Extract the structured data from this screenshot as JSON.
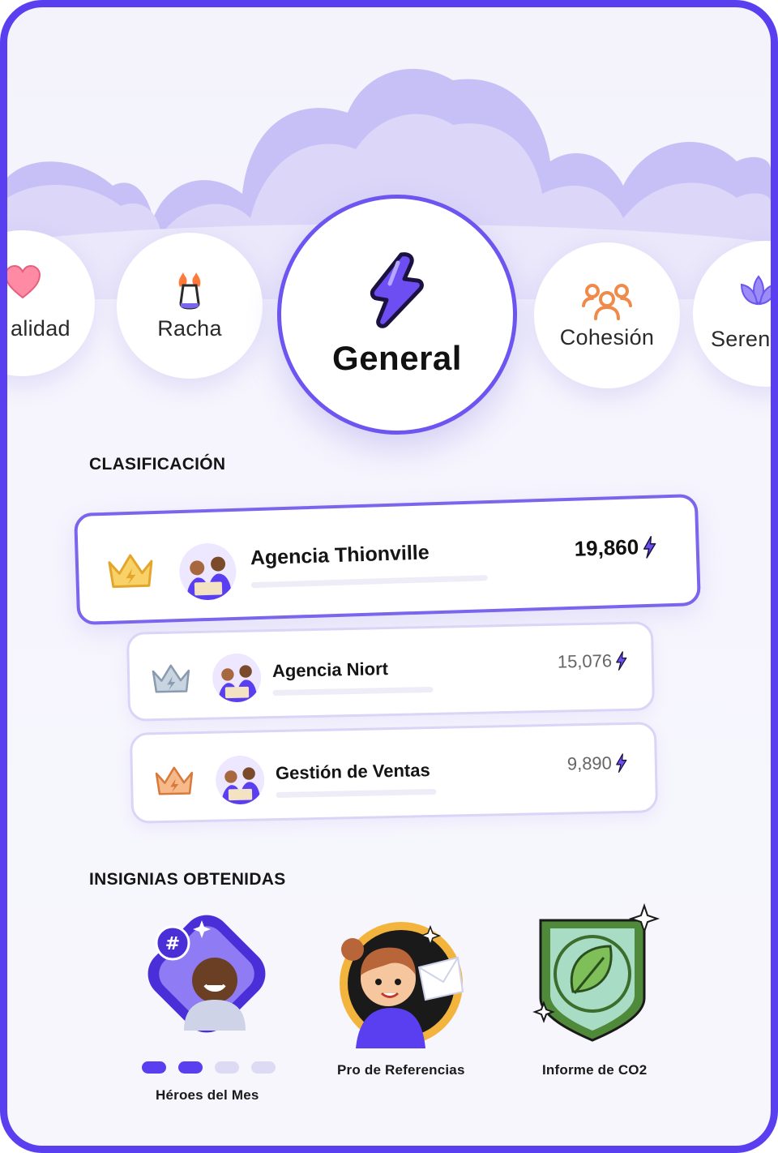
{
  "categories": {
    "left_partial": {
      "label": "alidad",
      "icon": "heart-icon"
    },
    "racha": {
      "label": "Racha",
      "icon": "shoe-fire-icon"
    },
    "general": {
      "label": "General",
      "icon": "lightning-icon"
    },
    "cohesion": {
      "label": "Cohesión",
      "icon": "group-icon"
    },
    "right_partial": {
      "label": "Seren",
      "icon": "lotus-icon"
    }
  },
  "ranking": {
    "title": "CLASIFICACIÓN",
    "entries": [
      {
        "name": "Agencia Thionville",
        "score": "19,860",
        "crown": "gold-crown-icon"
      },
      {
        "name": "Agencia Niort",
        "score": "15,076",
        "crown": "silver-crown-icon"
      },
      {
        "name": "Gestión de Ventas",
        "score": "9,890",
        "crown": "bronze-crown-icon"
      }
    ]
  },
  "badges": {
    "title": "INSIGNIAS OBTENIDAS",
    "items": [
      {
        "label": "Héroes del Mes",
        "icon": "hero-badge-icon"
      },
      {
        "label": "Pro de Referencias",
        "icon": "referral-badge-icon"
      },
      {
        "label": "Informe de CO2",
        "icon": "leaf-badge-icon"
      }
    ],
    "pager": {
      "active_dots": 2,
      "total_dots": 4
    }
  },
  "colors": {
    "accent": "#5a3ff0",
    "gold": "#f5c14a",
    "silver": "#a9b7c6",
    "bronze": "#e8925a"
  }
}
